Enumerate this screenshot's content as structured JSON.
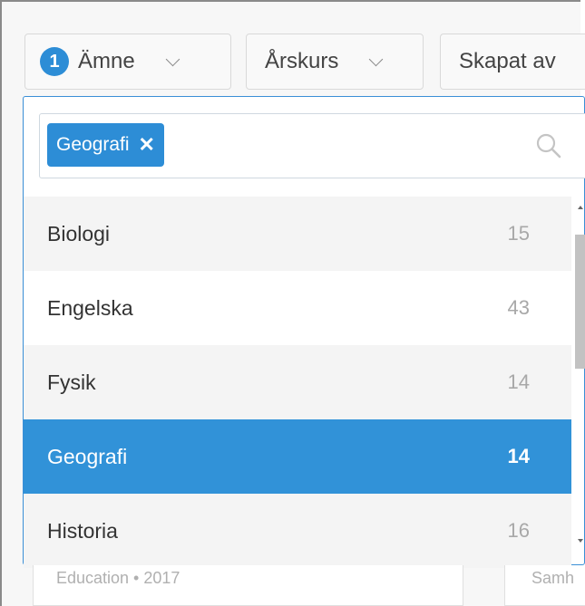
{
  "filters": {
    "amne": {
      "badge": "1",
      "label": "Ämne"
    },
    "arskurs": {
      "label": "Årskurs"
    },
    "skapat_av": {
      "label": "Skapat av"
    }
  },
  "dropdown": {
    "selected_chip": "Geografi",
    "chip_remove": "✕",
    "search_icon": "search-icon",
    "items": [
      {
        "label": "Biologi",
        "count": "15"
      },
      {
        "label": "Engelska",
        "count": "43"
      },
      {
        "label": "Fysik",
        "count": "14"
      },
      {
        "label": "Geografi",
        "count": "14",
        "selected": true
      },
      {
        "label": "Historia",
        "count": "16"
      }
    ]
  },
  "background_cards": {
    "left_meta": "Education • 2017",
    "right_meta": "Samh"
  },
  "colors": {
    "accent": "#2d8dd6",
    "selected_row": "#3192d8"
  }
}
